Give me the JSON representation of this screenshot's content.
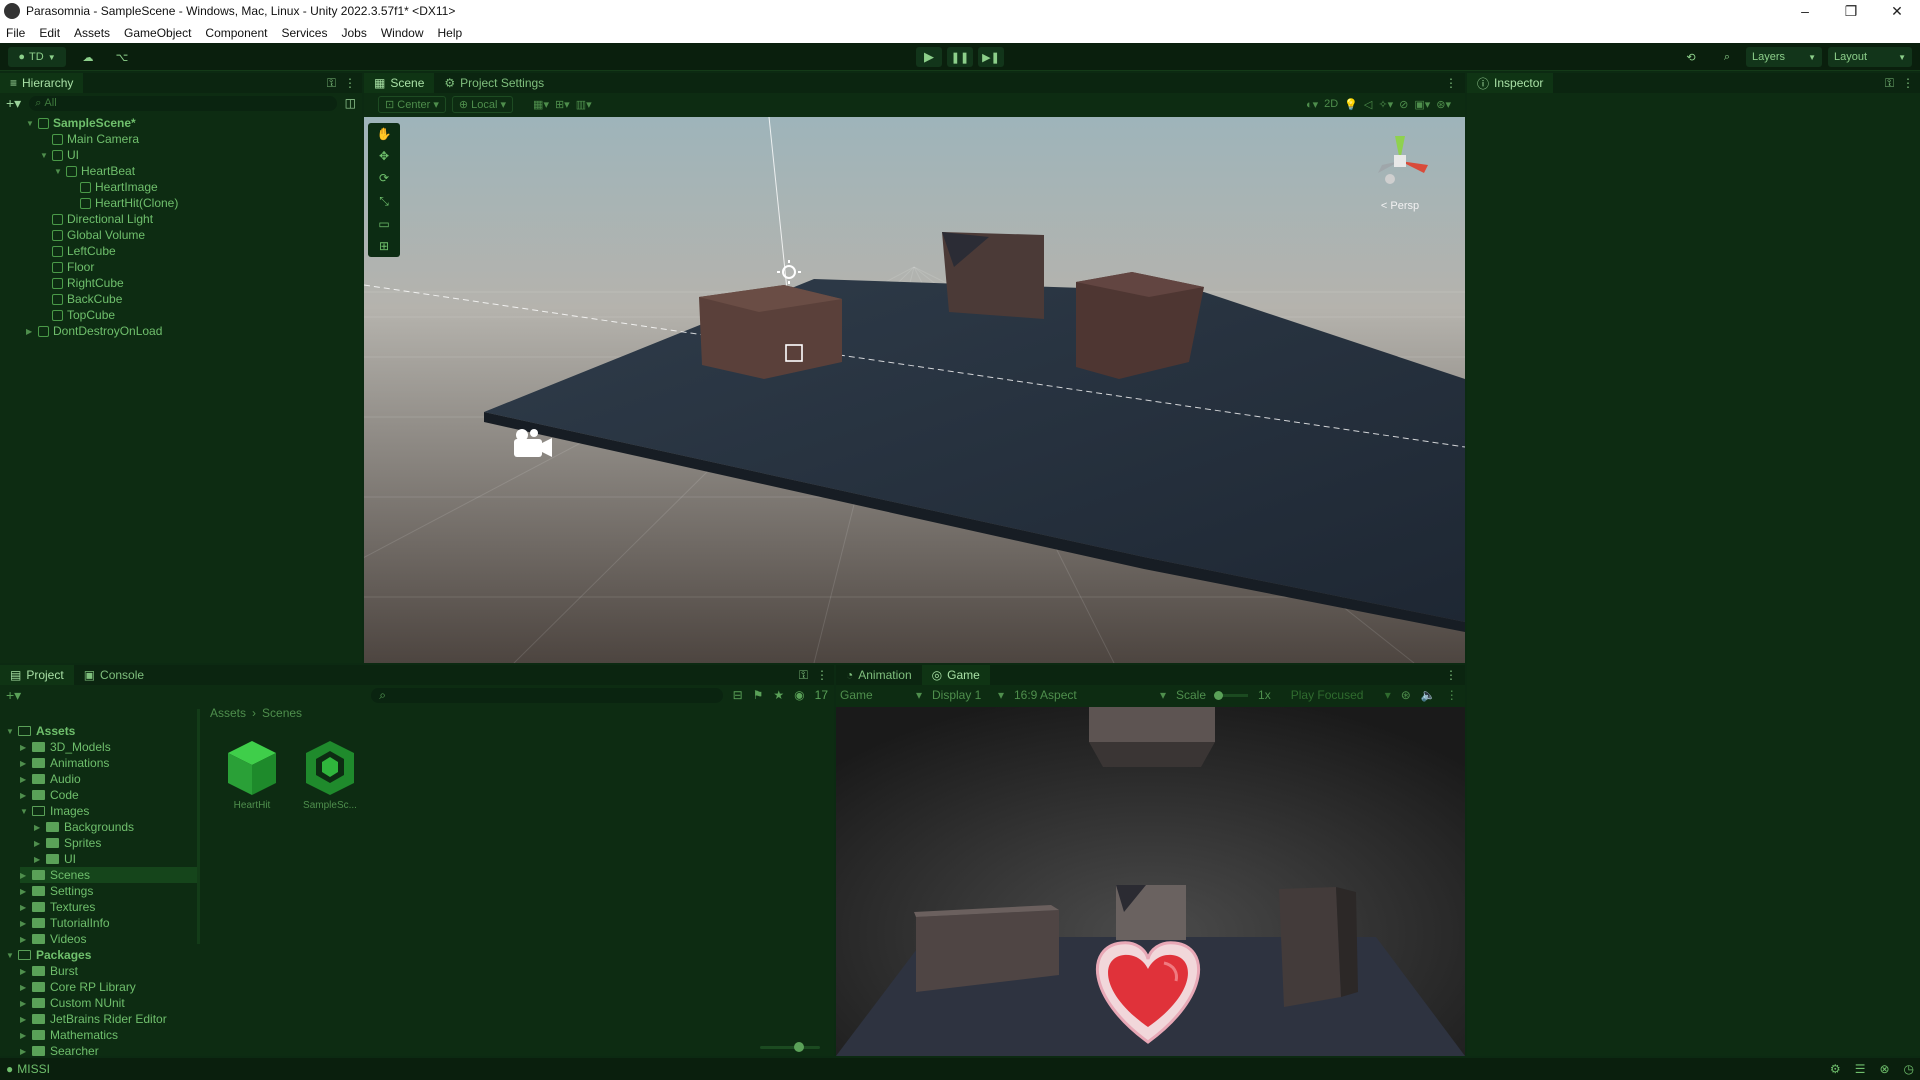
{
  "window": {
    "title": "Parasomnia - SampleScene - Windows, Mac, Linux - Unity 2022.3.57f1* <DX11>",
    "min": "–",
    "max": "❐",
    "close": "✕"
  },
  "menu": [
    "File",
    "Edit",
    "Assets",
    "GameObject",
    "Component",
    "Services",
    "Jobs",
    "Window",
    "Help"
  ],
  "toolbar": {
    "account": "TD",
    "layers": "Layers",
    "layout": "Layout"
  },
  "hierarchy": {
    "tab": "Hierarchy",
    "search_placeholder": "All",
    "items": [
      {
        "label": "SampleScene*",
        "depth": 0,
        "kind": "scene",
        "expanded": true
      },
      {
        "label": "Main Camera",
        "depth": 1
      },
      {
        "label": "UI",
        "depth": 1,
        "expanded": true
      },
      {
        "label": "HeartBeat",
        "depth": 2,
        "expanded": true
      },
      {
        "label": "HeartImage",
        "depth": 3
      },
      {
        "label": "HeartHit(Clone)",
        "depth": 3
      },
      {
        "label": "Directional Light",
        "depth": 1
      },
      {
        "label": "Global Volume",
        "depth": 1
      },
      {
        "label": "LeftCube",
        "depth": 1
      },
      {
        "label": "Floor",
        "depth": 1
      },
      {
        "label": "RightCube",
        "depth": 1
      },
      {
        "label": "BackCube",
        "depth": 1
      },
      {
        "label": "TopCube",
        "depth": 1
      },
      {
        "label": "DontDestroyOnLoad",
        "depth": 0,
        "kind": "scene"
      }
    ]
  },
  "scene": {
    "tabs": [
      "Scene",
      "Project Settings"
    ],
    "pivot": "Center",
    "space": "Local",
    "mode_2d": "2D",
    "persp": "Persp"
  },
  "inspector": {
    "tab": "Inspector"
  },
  "project": {
    "tabs": [
      "Project",
      "Console"
    ],
    "breadcrumb": [
      "Assets",
      "Scenes"
    ],
    "count": "17",
    "tree": [
      {
        "label": "Assets",
        "depth": 0,
        "bold": true,
        "open": true
      },
      {
        "label": "3D_Models",
        "depth": 1
      },
      {
        "label": "Animations",
        "depth": 1
      },
      {
        "label": "Audio",
        "depth": 1
      },
      {
        "label": "Code",
        "depth": 1
      },
      {
        "label": "Images",
        "depth": 1,
        "open": true
      },
      {
        "label": "Backgrounds",
        "depth": 2
      },
      {
        "label": "Sprites",
        "depth": 2
      },
      {
        "label": "UI",
        "depth": 2
      },
      {
        "label": "Scenes",
        "depth": 1,
        "selected": true
      },
      {
        "label": "Settings",
        "depth": 1
      },
      {
        "label": "Textures",
        "depth": 1
      },
      {
        "label": "TutorialInfo",
        "depth": 1
      },
      {
        "label": "Videos",
        "depth": 1
      },
      {
        "label": "Packages",
        "depth": 0,
        "bold": true,
        "open": true
      },
      {
        "label": "Burst",
        "depth": 1
      },
      {
        "label": "Core RP Library",
        "depth": 1
      },
      {
        "label": "Custom NUnit",
        "depth": 1
      },
      {
        "label": "JetBrains Rider Editor",
        "depth": 1
      },
      {
        "label": "Mathematics",
        "depth": 1
      },
      {
        "label": "Searcher",
        "depth": 1
      }
    ],
    "assets": [
      "HeartHit",
      "SampleSc..."
    ]
  },
  "game": {
    "tabs": [
      "Animation",
      "Game"
    ],
    "mode": "Game",
    "display": "Display 1",
    "aspect": "16:9 Aspect",
    "scale_label": "Scale",
    "scale_value": "1x",
    "play_focused": "Play Focused"
  },
  "statusbar": {
    "text": "MISSI"
  }
}
